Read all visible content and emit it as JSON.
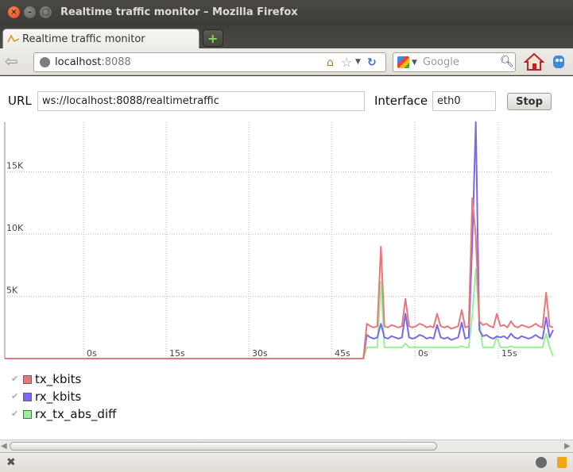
{
  "window": {
    "title": "Realtime traffic monitor – Mozilla Firefox"
  },
  "tab": {
    "label": "Realtime traffic monitor",
    "newtab_symbol": "+"
  },
  "navbar": {
    "host": "localhost",
    "port": ":8088",
    "search_placeholder": "Google"
  },
  "controls": {
    "url_label": "URL",
    "url_value": "ws://localhost:8088/realtimetraffic",
    "interface_label": "Interface",
    "interface_value": "eth0",
    "stop_label": "Stop"
  },
  "colors": {
    "tx_kbits": "#e8777a",
    "rx_kbits": "#7b68ee",
    "rx_tx_abs_diff": "#98f098"
  },
  "chart_data": {
    "type": "line",
    "y_ticks": [
      "5K",
      "10K",
      "15K"
    ],
    "x_ticks": [
      "0s",
      "15s",
      "30s",
      "45s",
      "0s",
      "15s"
    ],
    "ylim": [
      0,
      19000
    ],
    "grid": true,
    "legend": "bottom-left",
    "series": [
      {
        "name": "tx_kbits",
        "color": "#e8777a",
        "values": [
          0,
          0,
          0,
          0,
          0,
          0,
          0,
          0,
          0,
          0,
          0,
          0,
          0,
          0,
          0,
          0,
          0,
          0,
          0,
          0,
          0,
          0,
          0,
          0,
          0,
          0,
          0,
          0,
          0,
          0,
          0,
          0,
          0,
          0,
          0,
          0,
          0,
          0,
          0,
          0,
          0,
          0,
          0,
          0,
          0,
          0,
          0,
          0,
          0,
          0,
          0,
          0,
          0,
          0,
          0,
          0,
          0,
          0,
          0,
          0,
          0,
          0,
          0,
          0,
          0,
          0,
          0,
          0,
          0,
          0,
          0,
          0,
          0,
          0,
          0,
          0,
          0,
          0,
          0,
          0,
          0,
          0,
          0,
          0,
          0,
          0,
          0,
          0,
          0,
          0,
          0,
          0,
          0,
          0,
          0,
          0,
          0,
          0,
          0,
          0,
          0,
          0,
          0,
          2800,
          2600,
          2500,
          2600,
          9000,
          2600,
          2500,
          2700,
          2600,
          2500,
          2600,
          4800,
          2600,
          2500,
          2600,
          2800,
          2700,
          2500,
          2600,
          2500,
          3600,
          2600,
          2500,
          2600,
          2400,
          2500,
          2600,
          3900,
          2500,
          2600,
          12900,
          9800,
          3000,
          2700,
          2800,
          2600,
          2500,
          3600,
          2600,
          2700,
          2500,
          3000,
          2600,
          2500,
          2700,
          2600,
          2500,
          2600,
          2800,
          2600,
          2500,
          5300,
          2600,
          2500
        ]
      },
      {
        "name": "rx_kbits",
        "color": "#7b68ee",
        "values": [
          0,
          0,
          0,
          0,
          0,
          0,
          0,
          0,
          0,
          0,
          0,
          0,
          0,
          0,
          0,
          0,
          0,
          0,
          0,
          0,
          0,
          0,
          0,
          0,
          0,
          0,
          0,
          0,
          0,
          0,
          0,
          0,
          0,
          0,
          0,
          0,
          0,
          0,
          0,
          0,
          0,
          0,
          0,
          0,
          0,
          0,
          0,
          0,
          0,
          0,
          0,
          0,
          0,
          0,
          0,
          0,
          0,
          0,
          0,
          0,
          0,
          0,
          0,
          0,
          0,
          0,
          0,
          0,
          0,
          0,
          0,
          0,
          0,
          0,
          0,
          0,
          0,
          0,
          0,
          0,
          0,
          0,
          0,
          0,
          0,
          0,
          0,
          0,
          0,
          0,
          0,
          0,
          0,
          0,
          0,
          0,
          0,
          0,
          0,
          0,
          0,
          0,
          0,
          1900,
          1700,
          1600,
          1700,
          2800,
          1700,
          1600,
          1800,
          1700,
          1600,
          1700,
          3600,
          1700,
          1600,
          1700,
          1900,
          1800,
          1600,
          1700,
          1600,
          2700,
          1700,
          1600,
          1700,
          1500,
          1600,
          1700,
          2900,
          1600,
          1700,
          9400,
          19000,
          2300,
          1800,
          1900,
          1700,
          1600,
          1800,
          1700,
          1800,
          1600,
          2000,
          1700,
          1600,
          1800,
          1700,
          1600,
          1700,
          1900,
          1700,
          1600,
          3300,
          1700,
          2300
        ]
      },
      {
        "name": "rx_tx_abs_diff",
        "color": "#98f098",
        "values": [
          0,
          0,
          0,
          0,
          0,
          0,
          0,
          0,
          0,
          0,
          0,
          0,
          0,
          0,
          0,
          0,
          0,
          0,
          0,
          0,
          0,
          0,
          0,
          0,
          0,
          0,
          0,
          0,
          0,
          0,
          0,
          0,
          0,
          0,
          0,
          0,
          0,
          0,
          0,
          0,
          0,
          0,
          0,
          0,
          0,
          0,
          0,
          0,
          0,
          0,
          0,
          0,
          0,
          0,
          0,
          0,
          0,
          0,
          0,
          0,
          0,
          0,
          0,
          0,
          0,
          0,
          0,
          0,
          0,
          0,
          0,
          0,
          0,
          0,
          0,
          0,
          0,
          0,
          0,
          0,
          0,
          0,
          0,
          0,
          0,
          0,
          0,
          0,
          0,
          0,
          0,
          0,
          0,
          0,
          0,
          0,
          0,
          0,
          0,
          0,
          0,
          0,
          0,
          900,
          900,
          900,
          900,
          6200,
          900,
          900,
          900,
          900,
          900,
          900,
          1200,
          900,
          900,
          900,
          900,
          900,
          900,
          900,
          900,
          900,
          900,
          900,
          900,
          900,
          900,
          900,
          1000,
          900,
          900,
          3500,
          7200,
          3000,
          900,
          900,
          900,
          900,
          1800,
          900,
          900,
          900,
          1000,
          900,
          900,
          900,
          900,
          900,
          900,
          900,
          900,
          900,
          2000,
          900,
          200
        ]
      }
    ]
  }
}
